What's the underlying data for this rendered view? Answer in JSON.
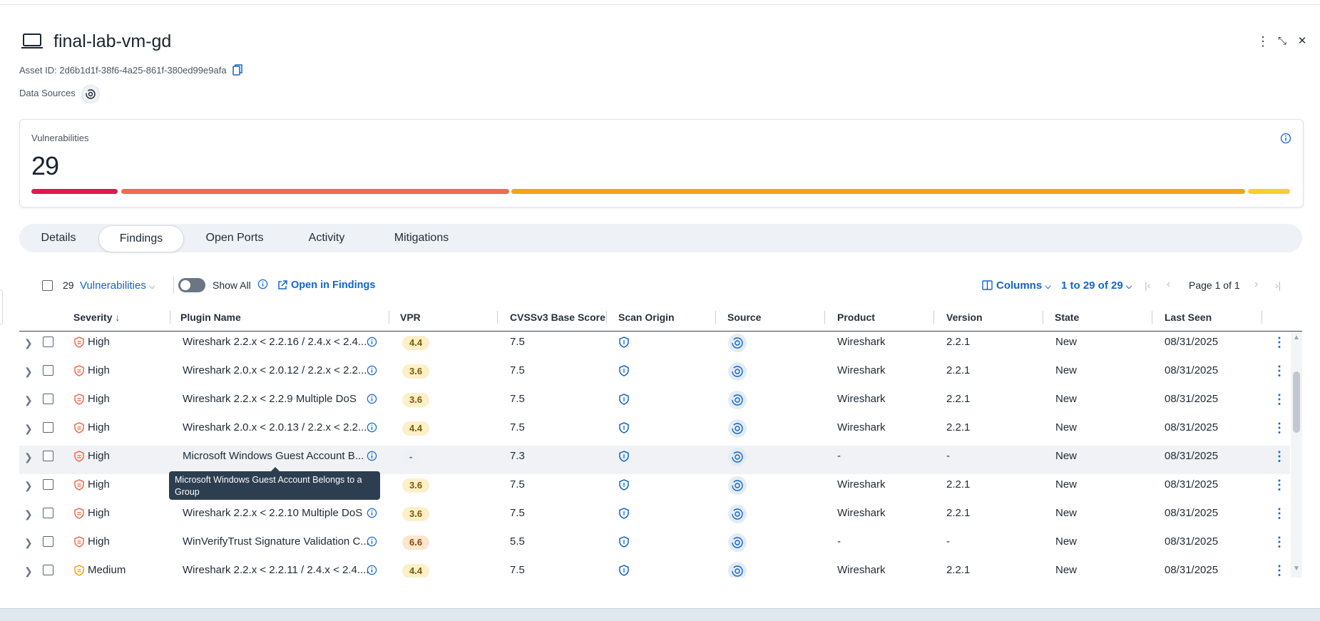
{
  "asset": {
    "title": "final-lab-vm-gd",
    "asset_id_text": "Asset ID: 2d6b1d1f-38f6-4a25-861f-380ed99e9afa",
    "data_sources_label": "Data Sources"
  },
  "window_controls": {
    "more_icon": "⋮",
    "collapse_icon": "⤡",
    "close_icon": "✕"
  },
  "summary": {
    "label": "Vulnerabilities",
    "count": "29",
    "colors": {
      "critical": "#e0184f",
      "high": "#f26b4b",
      "medium": "#f8a11c",
      "low": "#f6cf2e"
    }
  },
  "tabs": [
    {
      "label": "Details"
    },
    {
      "label": "Findings",
      "active": true
    },
    {
      "label": "Open Ports"
    },
    {
      "label": "Activity"
    },
    {
      "label": "Mitigations"
    }
  ],
  "toolbar": {
    "count": "29",
    "type_select": "Vulnerabilities",
    "show_all": "Show All",
    "open_in_findings": "Open in Findings",
    "columns": "Columns",
    "range": "1 to 29 of 29",
    "page": "Page 1 of 1"
  },
  "columns": [
    "Severity",
    "Plugin Name",
    "VPR",
    "CVSSv3 Base Score",
    "Scan Origin",
    "Source",
    "Product",
    "Version",
    "State",
    "Last Seen"
  ],
  "rows": [
    {
      "severity": "High",
      "plugin": "Wireshark 2.2.x < 2.2.16 / 2.4.x < 2.4....",
      "vpr": "4.4",
      "cvss": "7.5",
      "product": "Wireshark",
      "version": "2.2.1",
      "state": "New",
      "last_seen": "08/31/2025"
    },
    {
      "severity": "High",
      "plugin": "Wireshark 2.0.x < 2.0.12 / 2.2.x < 2.2....",
      "vpr": "3.6",
      "cvss": "7.5",
      "product": "Wireshark",
      "version": "2.2.1",
      "state": "New",
      "last_seen": "08/31/2025"
    },
    {
      "severity": "High",
      "plugin": "Wireshark 2.2.x < 2.2.9 Multiple DoS",
      "vpr": "3.6",
      "cvss": "7.5",
      "product": "Wireshark",
      "version": "2.2.1",
      "state": "New",
      "last_seen": "08/31/2025"
    },
    {
      "severity": "High",
      "plugin": "Wireshark 2.0.x < 2.0.13 / 2.2.x < 2.2....",
      "vpr": "4.4",
      "cvss": "7.5",
      "product": "Wireshark",
      "version": "2.2.1",
      "state": "New",
      "last_seen": "08/31/2025"
    },
    {
      "severity": "High",
      "plugin": "Microsoft Windows Guest Account B...",
      "vpr": "-",
      "cvss": "7.3",
      "product": "-",
      "version": "-",
      "state": "New",
      "last_seen": "08/31/2025"
    },
    {
      "severity": "High",
      "plugin": "",
      "vpr": "3.6",
      "cvss": "7.5",
      "product": "Wireshark",
      "version": "2.2.1",
      "state": "New",
      "last_seen": "08/31/2025"
    },
    {
      "severity": "High",
      "plugin": "Wireshark 2.2.x < 2.2.10 Multiple DoS",
      "vpr": "3.6",
      "cvss": "7.5",
      "product": "Wireshark",
      "version": "2.2.1",
      "state": "New",
      "last_seen": "08/31/2025"
    },
    {
      "severity": "High",
      "plugin": "WinVerifyTrust Signature Validation C...",
      "vpr": "6.6",
      "cvss": "5.5",
      "product": "-",
      "version": "-",
      "state": "New",
      "last_seen": "08/31/2025"
    },
    {
      "severity": "Medium",
      "plugin": "Wireshark 2.2.x < 2.2.11 / 2.4.x < 2.4....",
      "vpr": "4.4",
      "cvss": "7.5",
      "product": "Wireshark",
      "version": "2.2.1",
      "state": "New",
      "last_seen": "08/31/2025"
    }
  ],
  "tooltip": "Microsoft Windows Guest Account Belongs to a Group"
}
